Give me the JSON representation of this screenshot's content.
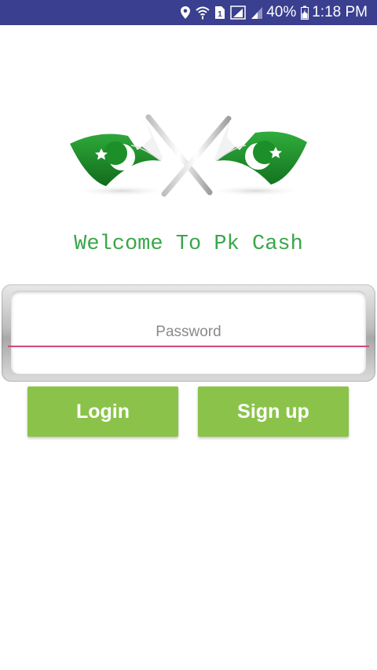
{
  "status_bar": {
    "battery_percent": "40%",
    "time": "1:18 PM",
    "sim_slot": "1",
    "icons": [
      "location-icon",
      "wifi-icon",
      "sim-icon",
      "signal-icon",
      "signal-icon",
      "battery-icon"
    ]
  },
  "welcome": {
    "title": "Welcome To Pk Cash"
  },
  "login_form": {
    "password_placeholder": "Password",
    "login_label": "Login",
    "signup_label": "Sign up"
  },
  "colors": {
    "status_bar": "#3a3f8f",
    "accent_green": "#3aa64a",
    "button_green": "#8bc34a",
    "input_underline": "#d1477f",
    "flag_green": "#1f8a2a"
  }
}
